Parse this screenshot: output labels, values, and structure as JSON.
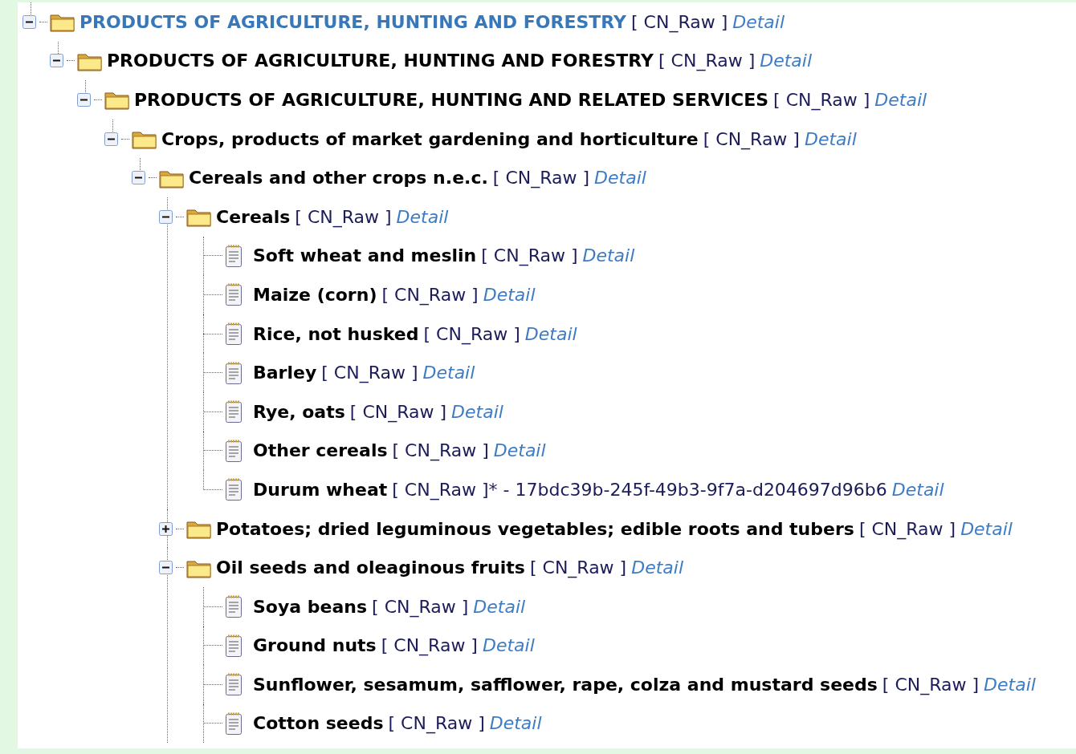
{
  "tree": {
    "nodes": [
      {
        "kind": "folder",
        "label": "PRODUCTS OF AGRICULTURE, HUNTING AND FORESTRY",
        "tag": "[ CN_Raw ]",
        "link": "Detail",
        "selected": true,
        "expanded": true,
        "children": [
          {
            "kind": "folder",
            "label": "PRODUCTS OF AGRICULTURE, HUNTING AND FORESTRY",
            "tag": "[ CN_Raw ]",
            "link": "Detail",
            "selected": false,
            "expanded": true,
            "children": [
              {
                "kind": "folder",
                "label": "PRODUCTS OF AGRICULTURE, HUNTING AND RELATED SERVICES",
                "tag": "[ CN_Raw ]",
                "link": "Detail",
                "selected": false,
                "expanded": true,
                "children": [
                  {
                    "kind": "folder",
                    "label": "Crops, products of market gardening and horticulture",
                    "tag": "[ CN_Raw ]",
                    "link": "Detail",
                    "selected": false,
                    "expanded": true,
                    "children": [
                      {
                        "kind": "folder",
                        "label": "Cereals and other crops n.e.c.",
                        "tag": "[ CN_Raw ]",
                        "link": "Detail",
                        "selected": false,
                        "expanded": true,
                        "continues": true,
                        "children": [
                          {
                            "kind": "folder",
                            "label": "Cereals",
                            "tag": "[ CN_Raw ]",
                            "link": "Detail",
                            "selected": false,
                            "expanded": true,
                            "children": [
                              {
                                "kind": "leaf",
                                "label": "Soft wheat and meslin",
                                "tag": "[ CN_Raw ]",
                                "link": "Detail",
                                "selected": false
                              },
                              {
                                "kind": "leaf",
                                "label": "Maize (corn)",
                                "tag": "[ CN_Raw ]",
                                "link": "Detail",
                                "selected": false
                              },
                              {
                                "kind": "leaf",
                                "label": "Rice, not husked",
                                "tag": "[ CN_Raw ]",
                                "link": "Detail",
                                "selected": false
                              },
                              {
                                "kind": "leaf",
                                "label": "Barley",
                                "tag": "[ CN_Raw ]",
                                "link": "Detail",
                                "selected": false
                              },
                              {
                                "kind": "leaf",
                                "label": "Rye, oats",
                                "tag": "[ CN_Raw ]",
                                "link": "Detail",
                                "selected": false
                              },
                              {
                                "kind": "leaf",
                                "label": "Other cereals",
                                "tag": "[ CN_Raw ]",
                                "link": "Detail",
                                "selected": false
                              },
                              {
                                "kind": "leaf",
                                "label": "Durum wheat",
                                "tag": "[ CN_Raw ]",
                                "suffix": "* - 17bdc39b-245f-49b3-9f7a-d204697d96b6",
                                "link": "Detail",
                                "selected": false
                              }
                            ]
                          },
                          {
                            "kind": "folder",
                            "label": "Potatoes; dried leguminous vegetables; edible roots and tubers",
                            "tag": "[ CN_Raw ]",
                            "link": "Detail",
                            "selected": false,
                            "expanded": false
                          },
                          {
                            "kind": "folder",
                            "label": "Oil seeds and oleaginous fruits",
                            "tag": "[ CN_Raw ]",
                            "link": "Detail",
                            "selected": false,
                            "expanded": true,
                            "continues": true,
                            "children": [
                              {
                                "kind": "leaf",
                                "label": "Soya beans",
                                "tag": "[ CN_Raw ]",
                                "link": "Detail",
                                "selected": false
                              },
                              {
                                "kind": "leaf",
                                "label": "Ground nuts",
                                "tag": "[ CN_Raw ]",
                                "link": "Detail",
                                "selected": false
                              },
                              {
                                "kind": "leaf",
                                "label": "Sunflower, sesamum, safflower, rape, colza and mustard seeds",
                                "tag": "[ CN_Raw ]",
                                "link": "Detail",
                                "selected": false
                              },
                              {
                                "kind": "leaf",
                                "label": "Cotton seeds",
                                "tag": "[ CN_Raw ]",
                                "link": "Detail",
                                "selected": false
                              }
                            ]
                          }
                        ]
                      }
                    ]
                  }
                ]
              }
            ]
          }
        ]
      }
    ]
  }
}
